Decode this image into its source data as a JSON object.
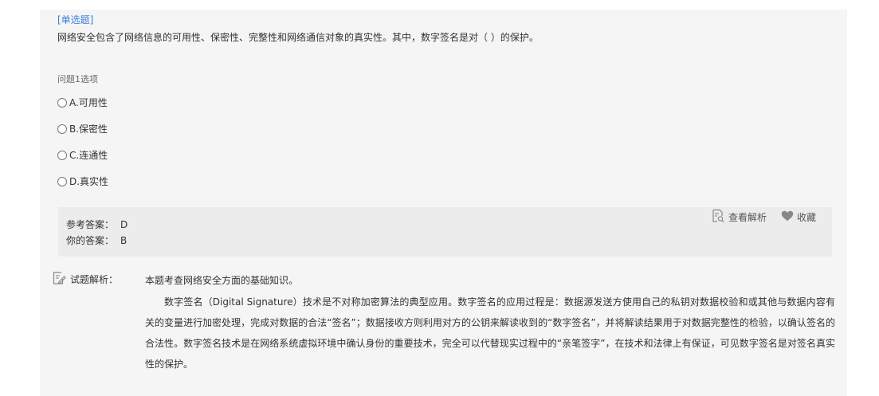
{
  "question": {
    "type_label": "[单选题]",
    "stem": "网络安全包含了网络信息的可用性、保密性、完整性和网络通信对象的真实性。其中，数字签名是对（ ）的保护。",
    "options_title": "问题1选项",
    "options": [
      {
        "label": "A.可用性"
      },
      {
        "label": "B.保密性"
      },
      {
        "label": "C.连通性"
      },
      {
        "label": "D.真实性"
      }
    ]
  },
  "answer": {
    "reference_label": "参考答案：",
    "reference_value": "D",
    "yours_label": "你的答案：",
    "yours_value": "B",
    "view_analysis_label": "查看解析",
    "favorite_label": "收藏"
  },
  "analysis": {
    "label": "试题解析：",
    "intro": "本题考查网络安全方面的基础知识。",
    "paragraph": "数字签名（Digital Signature）技术是不对称加密算法的典型应用。数字签名的应用过程是：数据源发送方使用自己的私钥对数据校验和或其他与数据内容有关的变量进行加密处理，完成对数据的合法“签名”；数据接收方则利用对方的公钥来解读收到的“数字签名”，并将解读结果用于对数据完整性的检验，以确认签名的合法性。数字签名技术是在网络系统虚拟环境中确认身份的重要技术，完全可以代替现实过程中的“亲笔签字”，在技术和法律上有保证，可见数字签名是对签名真实性的保护。"
  },
  "colors": {
    "accent": "#3b7ddd",
    "card_bg": "#f5f5f5",
    "answer_bg": "#ececec"
  },
  "icons": {
    "view_analysis": "magnifier-document-icon",
    "favorite": "heart-icon",
    "analysis": "edit-document-icon"
  }
}
